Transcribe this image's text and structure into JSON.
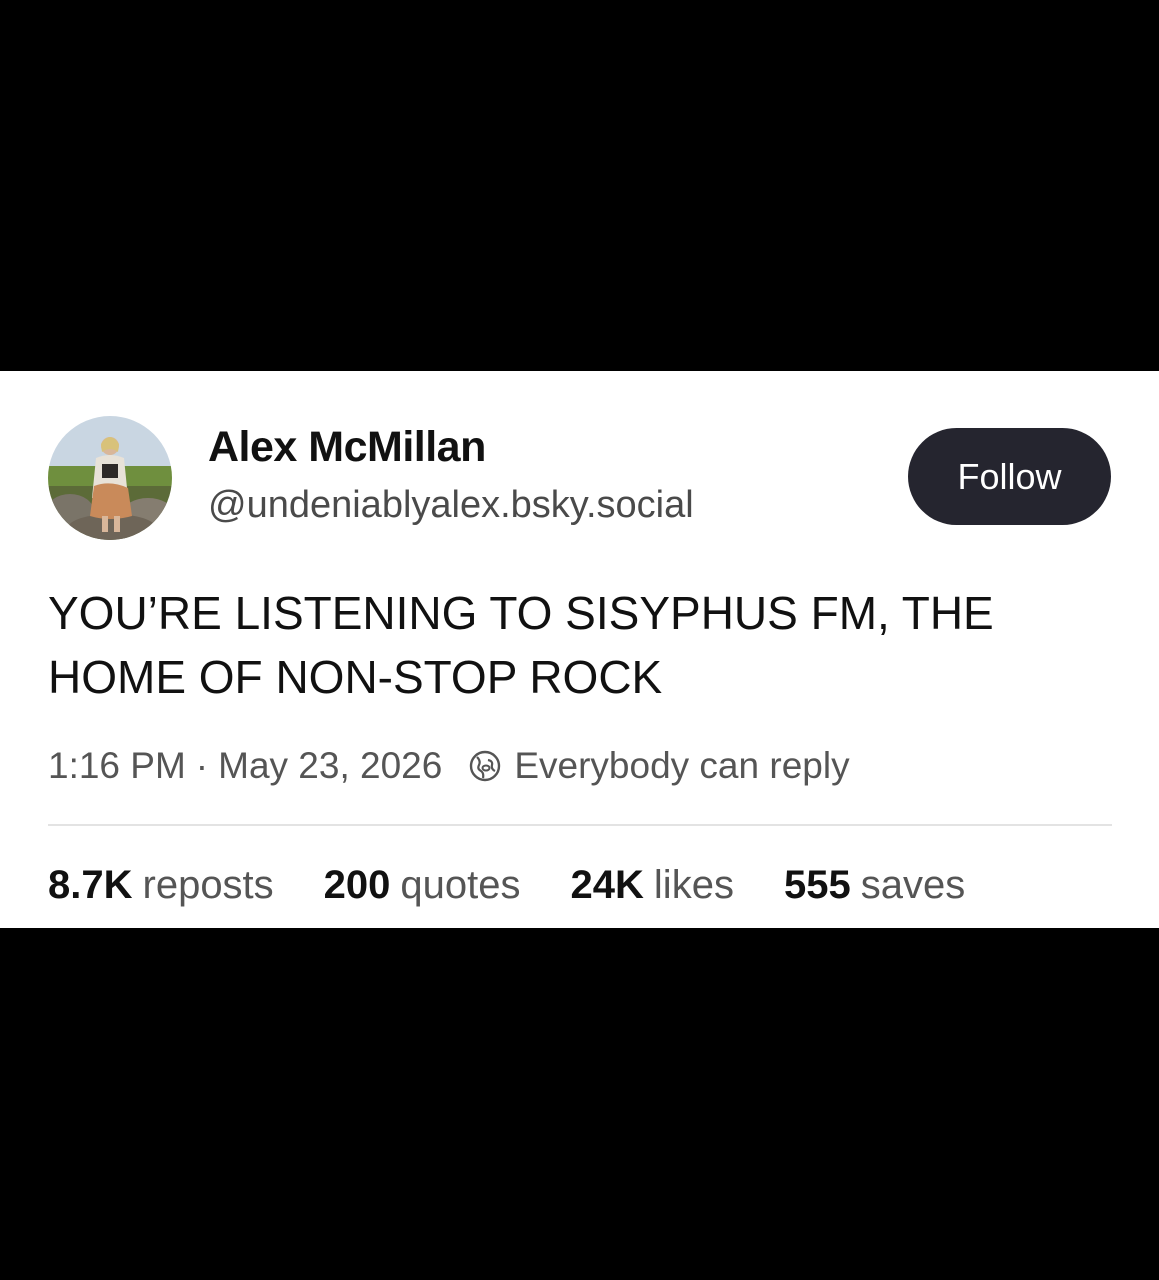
{
  "post": {
    "author": {
      "display_name": "Alex McMillan",
      "handle": "@undeniablyalex.bsky.social",
      "avatar_icon": "profile-photo"
    },
    "follow_label": "Follow",
    "text": "YOU’RE LISTENING TO SISYPHUS FM, THE HOME OF NON-STOP ROCK",
    "time": "1:16 PM",
    "separator": "·",
    "date": "May 23, 2026",
    "reply_setting": "Everybody can reply",
    "reply_icon": "globe-reply-icon",
    "stats": [
      {
        "count": "8.7K",
        "label": "reposts"
      },
      {
        "count": "200",
        "label": "quotes"
      },
      {
        "count": "24K",
        "label": "likes"
      },
      {
        "count": "555",
        "label": "saves"
      }
    ]
  },
  "colors": {
    "background": "#000000",
    "card": "#ffffff",
    "button": "#25252f",
    "primary_text": "#111111",
    "secondary_text": "#555555"
  }
}
